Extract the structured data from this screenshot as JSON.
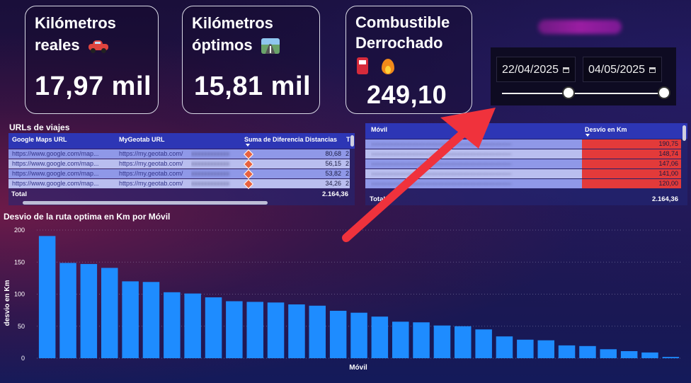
{
  "kpi_cards": [
    {
      "title_line1": "Kilómetros",
      "title_line2": "reales",
      "value": "17,97 mil",
      "icon": "car-icon"
    },
    {
      "title_line1": "Kilómetros",
      "title_line2": "óptimos",
      "value": "15,81 mil",
      "icon": "road-icon"
    },
    {
      "title_line1": "Combustible",
      "title_line2": "Derrochado",
      "value": "249,10",
      "icons": [
        "fuel-pump-icon",
        "fire-icon"
      ]
    }
  ],
  "date_slicer": {
    "start": "22/04/2025",
    "end": "04/05/2025",
    "range_fraction": [
      0.0,
      1.0
    ],
    "start_knob_fraction": 0.4
  },
  "urls_table": {
    "title": "URLs de viajes",
    "columns": [
      "Google Maps URL",
      "MyGeotab URL",
      "Suma de Diferencia Distancias",
      "T"
    ],
    "rows": [
      {
        "maps": "https://www.google.com/map...",
        "geotab": "https://my.geotab.com/",
        "value": "80,68",
        "extra": "2"
      },
      {
        "maps": "https://www.google.com/map...",
        "geotab": "https://my.geotab.com/",
        "value": "56,15",
        "extra": "2"
      },
      {
        "maps": "https://www.google.com/map...",
        "geotab": "https://my.geotab.com/",
        "value": "53,82",
        "extra": "2"
      },
      {
        "maps": "https://www.google.com/map...",
        "geotab": "https://my.geotab.com/",
        "value": "34,26",
        "extra": "2"
      }
    ],
    "total_label": "Total",
    "total_value": "2.164,36"
  },
  "movil_table": {
    "columns": [
      "Móvil",
      "Desvío en Km"
    ],
    "rows": [
      {
        "movil": "",
        "value": "190,75"
      },
      {
        "movil": "",
        "value": "148,74"
      },
      {
        "movil": "",
        "value": "147,06"
      },
      {
        "movil": "",
        "value": "141,00"
      },
      {
        "movil": "",
        "value": "120,00"
      }
    ],
    "total_label": "Total",
    "total_value": "2.164,36"
  },
  "chart_data": {
    "type": "bar",
    "title": "Desvio de la ruta optima en Km por Móvil",
    "xlabel": "Móvil",
    "ylabel": "desvio en Km",
    "ylim": [
      0,
      200
    ],
    "yticks": [
      0,
      50,
      100,
      150,
      200
    ],
    "grid": true,
    "color": "#1e8cff",
    "values": [
      190.75,
      148.74,
      147.06,
      141.0,
      120.0,
      119,
      103,
      101,
      95,
      89,
      88,
      87,
      84,
      82,
      74,
      71,
      65,
      57,
      56,
      51,
      50,
      45,
      34,
      29,
      28,
      20,
      19,
      14,
      11,
      9,
      2
    ]
  }
}
